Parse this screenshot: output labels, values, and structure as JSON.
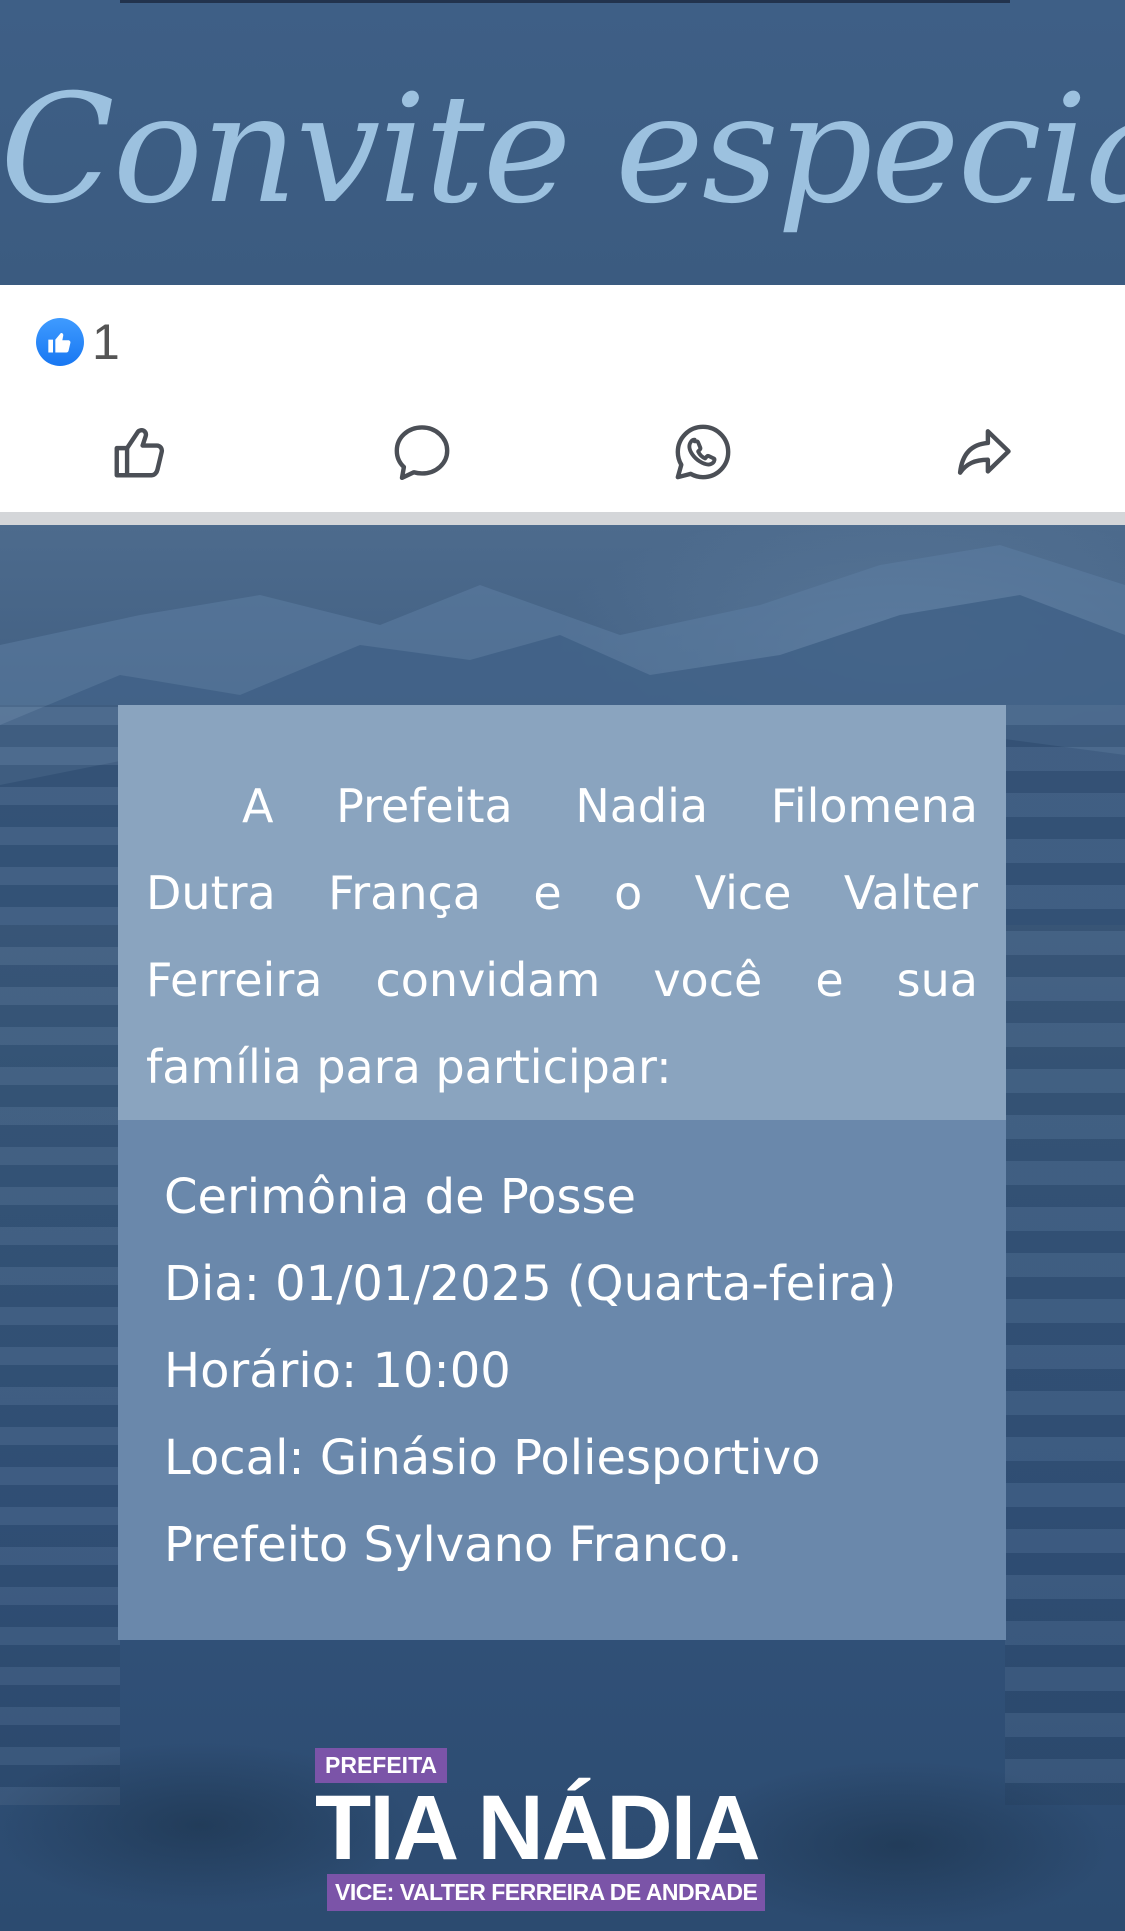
{
  "banner": {
    "title": "Convite especial"
  },
  "reactions": {
    "like_count": "1"
  },
  "actions": [
    {
      "name": "like",
      "icon": "thumbs-up-icon"
    },
    {
      "name": "comment",
      "icon": "comment-bubble-icon"
    },
    {
      "name": "whatsapp",
      "icon": "whatsapp-icon"
    },
    {
      "name": "share",
      "icon": "share-arrow-icon"
    }
  ],
  "invitation": {
    "intro": "A Prefeita Nadia Filomena Dutra França e o Vice Valter Ferreira convidam você e sua família para participar:",
    "event": "Cerimônia de Posse",
    "date": "Dia: 01/01/2025 (Quarta-feira)",
    "time": "Horário: 10:00",
    "place_line1": "Local: Ginásio Poliesportivo",
    "place_line2": "Prefeito Sylvano Franco."
  },
  "logo": {
    "tag": "PREFEITA",
    "name": "TIA NÁDIA",
    "vice": "VICE: VALTER FERREIRA DE ANDRADE"
  },
  "colors": {
    "like_blue": "#1877f2",
    "banner_bg": "#3e5f86",
    "banner_text": "#9cc1df",
    "card_top": "#8aa4bf",
    "card_bottom": "#6a88ab",
    "logo_purple": "#7b54a8"
  }
}
